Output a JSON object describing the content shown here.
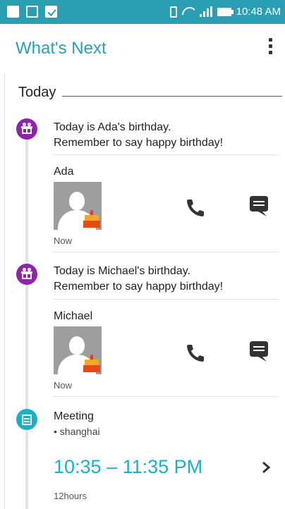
{
  "status_bar": {
    "time": "10:48 AM",
    "icons": [
      "clock-notification-icon",
      "image-notification-icon",
      "check-notification-icon",
      "vibrate-icon",
      "wifi-icon",
      "signal-icon",
      "battery-icon"
    ]
  },
  "app_bar": {
    "title": "What's Next",
    "menu_icon": "overflow-menu-icon"
  },
  "section": {
    "title": "Today"
  },
  "colors": {
    "accent": "#2a9fb3",
    "birthday_badge": "#8e24aa",
    "meeting_badge": "#1ab0c8"
  },
  "cards": [
    {
      "type": "birthday",
      "icon": "gift-icon",
      "line1": "Today is Ada's birthday.",
      "line2": "Remember to say happy birthday!",
      "contact_name": "Ada",
      "time_label": "Now",
      "actions": [
        "phone-icon",
        "message-icon"
      ]
    },
    {
      "type": "birthday",
      "icon": "gift-icon",
      "line1": "Today is Michael's birthday.",
      "line2": "Remember to say happy birthday!",
      "contact_name": "Michael",
      "time_label": "Now",
      "actions": [
        "phone-icon",
        "message-icon"
      ]
    }
  ],
  "meeting": {
    "icon": "calendar-icon",
    "title": "Meeting",
    "location": "• shanghai",
    "time_range": "10:35 – 11:35 PM",
    "duration": "12hours"
  }
}
